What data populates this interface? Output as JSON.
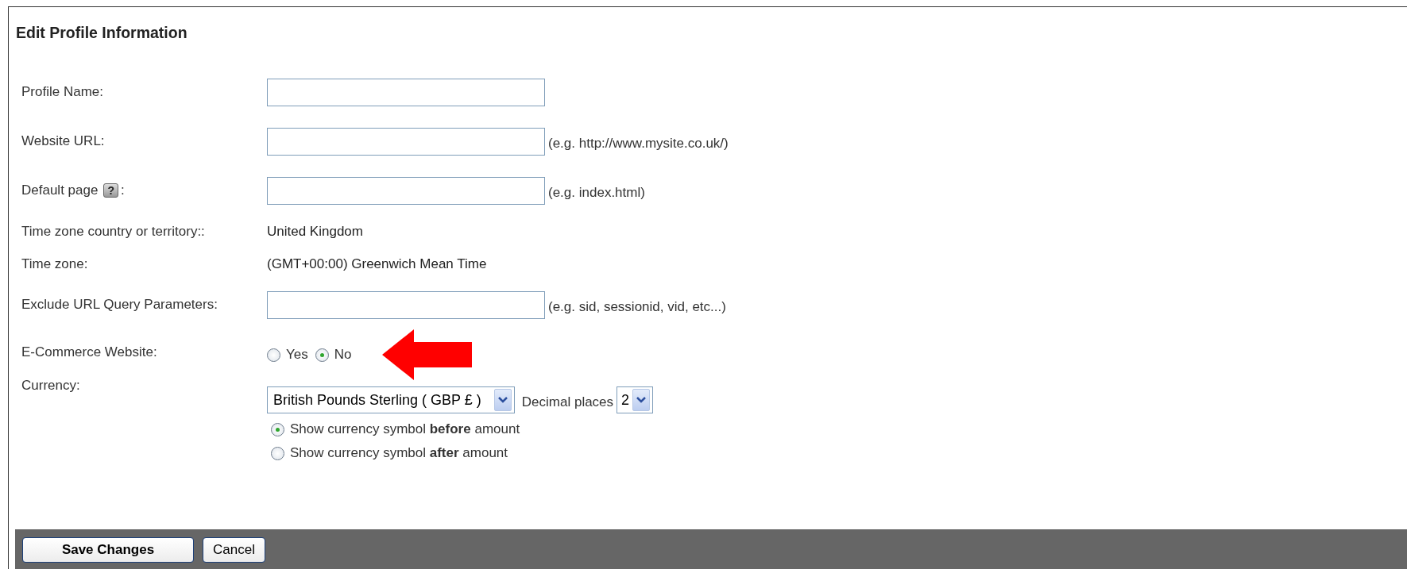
{
  "title": "Edit Profile Information",
  "fields": [
    {
      "kind": "input",
      "label": "Profile Name:"
    },
    {
      "kind": "input",
      "label": "Website URL:",
      "note": "(e.g. http://www.mysite.co.uk/)"
    },
    {
      "kind": "input",
      "label": "Default page",
      "help": "?",
      "label_end": ":",
      "note": "(e.g. index.html)"
    },
    {
      "kind": "text",
      "label": "Time zone country or territory::",
      "value": "United Kingdom"
    },
    {
      "kind": "text",
      "label": "Time zone:",
      "value": "(GMT+00:00) Greenwich Mean Time"
    },
    {
      "kind": "input",
      "label": "Exclude URL Query Parameters:",
      "note": "(e.g. sid, sessionid, vid, etc...)"
    },
    {
      "kind": "radios",
      "label": "E-Commerce Website:",
      "options": [
        {
          "label": "Yes",
          "selected": false
        },
        {
          "label": "No",
          "selected": true
        }
      ]
    },
    {
      "kind": "currency",
      "label": "Currency:",
      "currency": "British Pounds Sterling ( GBP £ )",
      "decimal_label": "Decimal places",
      "decimal_value": "2",
      "options": [
        {
          "label": "Show currency symbol **before** amount",
          "selected": true
        },
        {
          "label": "Show currency symbol **after** amount",
          "selected": false
        }
      ]
    }
  ],
  "buttons": [
    {
      "label": "Save Changes",
      "primary": true
    },
    {
      "label": "Cancel",
      "primary": false
    }
  ]
}
